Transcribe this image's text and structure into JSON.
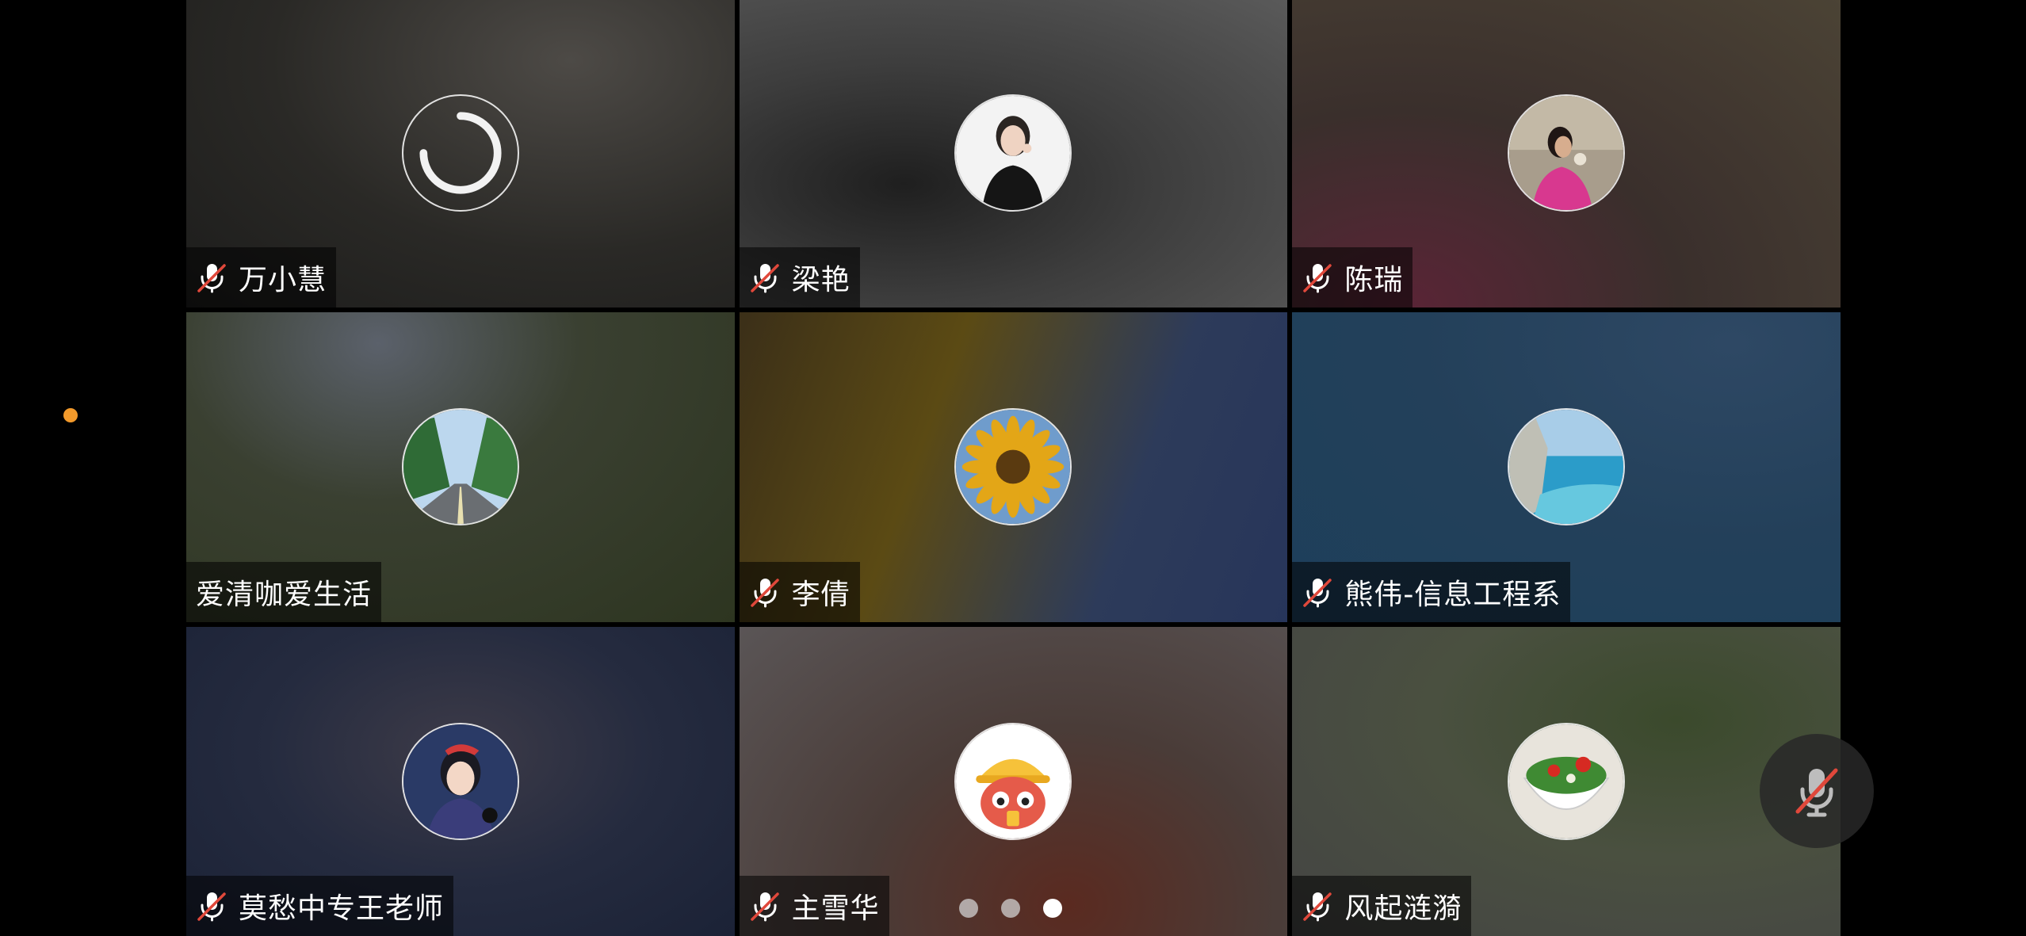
{
  "participants": [
    {
      "name": "万小慧",
      "muted": true,
      "avatar": "loading-spinner",
      "bg": "radial-gradient(ellipse at 70% 20%, #4d4a46 0%, #2a2926 55%, #1c1c1b 100%)"
    },
    {
      "name": "梁艳",
      "muted": true,
      "avatar": "girl-photo",
      "bg": "radial-gradient(ellipse at 30% 60%, #1f1f1f 0%, #3d3d3d 45%, #5a5a5a 100%)"
    },
    {
      "name": "陈瑞",
      "muted": true,
      "avatar": "woman-with-flowers-photo",
      "bg": "radial-gradient(ellipse at 20% 100%, #5a2436 0%, #3a2f2c 45%, #4b4335 100%)"
    },
    {
      "name": "爱清咖爱生活",
      "muted": false,
      "avatar": "tree-lined-road-photo",
      "bg": "radial-gradient(ellipse at 35% 10%, #5b616b 0%, #3a4031 40%, #2d3520 100%)"
    },
    {
      "name": "李倩",
      "muted": true,
      "avatar": "sunflower-photo",
      "bg": "linear-gradient(110deg, #3b2f18 0%, #5b4a14 35%, #2d3b5a 70%, #27355a 100%)"
    },
    {
      "name": "熊伟-信息工程系",
      "muted": true,
      "avatar": "seaside-cliff-photo",
      "bg": "radial-gradient(ellipse at 80% 10%, #2e4864 0%, #23405a 50%, #1d3f5b 100%)"
    },
    {
      "name": "莫愁中专王老师",
      "muted": true,
      "avatar": "anime-witch-girl",
      "bg": "radial-gradient(ellipse at 50% 40%, #3d3b48 0%, #252b3f 50%, #1b2236 100%)"
    },
    {
      "name": "主雪华",
      "muted": true,
      "avatar": "cartoon-duck-hat",
      "bg": "radial-gradient(ellipse at 60% 90%, #5a2a20 0%, #4a3c38 45%, #5a5556 100%)"
    },
    {
      "name": "风起涟漪",
      "muted": true,
      "avatar": "salad-bowl-photo",
      "bg": "radial-gradient(ellipse at 70% 30%, #3b4a2c 0%, #4a5040 45%, #444 100%)"
    }
  ],
  "pagination": {
    "total": 3,
    "active": 3
  },
  "colors": {
    "recording_dot": "#f39a2b",
    "muted_slash": "#e0483b"
  },
  "icons": {
    "mic_muted": "mic-muted-icon",
    "fab": "mic-toggle-icon"
  }
}
